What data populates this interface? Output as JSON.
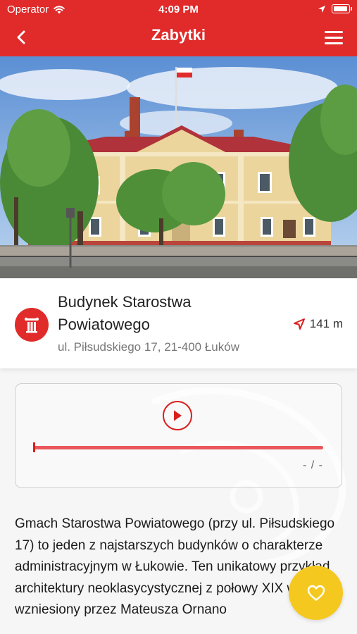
{
  "status_bar": {
    "carrier": "Operator",
    "time": "4:09 PM"
  },
  "nav": {
    "title": "Zabytki",
    "back_icon": "chevron-left-icon",
    "menu_icon": "hamburger-menu-icon"
  },
  "hero": {
    "image": "photo of the Budynek Starostwa Powiatowego building"
  },
  "place": {
    "category_icon": "column-icon",
    "name": "Budynek Starostwa Powiatowego",
    "address": "ul. Piłsudskiego 17, 21-400 Łuków",
    "distance": "141 m",
    "distance_icon": "location-arrow-icon"
  },
  "audio_player": {
    "play_icon": "play-icon",
    "progress": 0,
    "time": "- / -"
  },
  "description": "Gmach Starostwa Powiatowego (przy ul. Piłsudskiego 17) to jeden z najstarszych budynków o charakterze administracyjnym w Łukowie. Ten unikatowy przykład architektury neoklasycystycznej z połowy XIX w. został wzniesiony przez Mateusza Ornano",
  "favorite": {
    "icon": "heart-icon"
  },
  "colors": {
    "brand": "#e12a2a",
    "accent": "#f5c81f"
  }
}
